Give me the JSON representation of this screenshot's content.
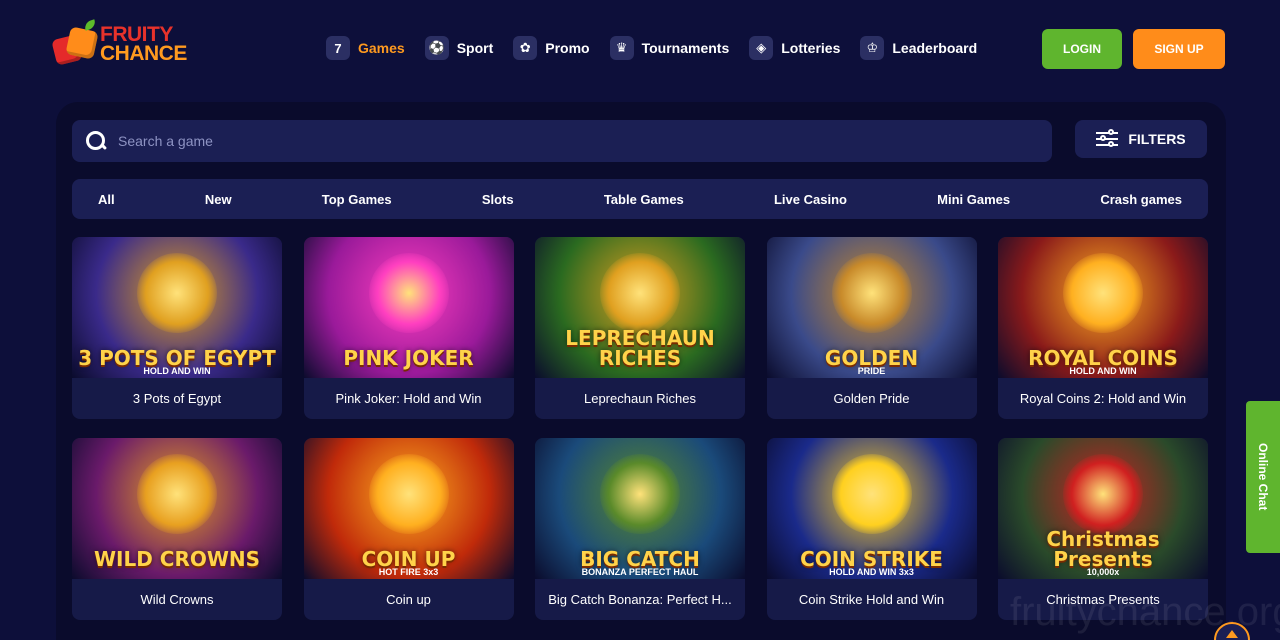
{
  "brand": {
    "line1": "FRUITY",
    "line2": "CHANCE"
  },
  "nav": {
    "items": [
      {
        "label": "Games",
        "icon": "seven-icon",
        "glyph": "7",
        "active": true
      },
      {
        "label": "Sport",
        "icon": "ball-icon",
        "glyph": "⚽",
        "active": false
      },
      {
        "label": "Promo",
        "icon": "clover-icon",
        "glyph": "✿",
        "active": false
      },
      {
        "label": "Tournaments",
        "icon": "trophy-icon",
        "glyph": "♛",
        "active": false
      },
      {
        "label": "Lotteries",
        "icon": "dice-icon",
        "glyph": "◈",
        "active": false
      },
      {
        "label": "Leaderboard",
        "icon": "crown-icon",
        "glyph": "♔",
        "active": false
      }
    ],
    "login": "LOGIN",
    "signup": "SIGN UP"
  },
  "search": {
    "placeholder": "Search a game",
    "filters_label": "FILTERS"
  },
  "categories": [
    "All",
    "New",
    "Top Games",
    "Slots",
    "Table Games",
    "Live Casino",
    "Mini Games",
    "Crash games"
  ],
  "games": [
    {
      "name": "3 Pots of Egypt",
      "art_title": "3 POTS OF EGYPT",
      "art_sub": "HOLD AND WIN",
      "bg": "#3a2a8a",
      "accent": "#e0a020"
    },
    {
      "name": "Pink Joker: Hold and Win",
      "art_title": "PINK JOKER",
      "art_sub": "",
      "bg": "#9a1a9a",
      "accent": "#ff3fc0"
    },
    {
      "name": "Leprechaun Riches",
      "art_title": "LEPRECHAUN RICHES",
      "art_sub": "",
      "bg": "#2a6a20",
      "accent": "#e0a020"
    },
    {
      "name": "Golden Pride",
      "art_title": "GOLDEN",
      "art_sub": "PRIDE",
      "bg": "#3a4a8a",
      "accent": "#c88a2a"
    },
    {
      "name": "Royal Coins 2: Hold and Win",
      "art_title": "ROYAL COINS",
      "art_sub": "HOLD AND WIN",
      "bg": "#8a1a1a",
      "accent": "#ffb020"
    },
    {
      "name": "Wild Crowns",
      "art_title": "WILD CROWNS",
      "art_sub": "",
      "bg": "#6a1a6a",
      "accent": "#e8a020"
    },
    {
      "name": "Coin up",
      "art_title": "COIN UP",
      "art_sub": "HOT FIRE 3x3",
      "bg": "#c02a0a",
      "accent": "#ffb020"
    },
    {
      "name": "Big Catch Bonanza: Perfect H...",
      "art_title": "BIG CATCH",
      "art_sub": "BONANZA PERFECT HAUL",
      "bg": "#1a4a7a",
      "accent": "#5a8a2a"
    },
    {
      "name": "Coin Strike Hold and Win",
      "art_title": "COIN STRIKE",
      "art_sub": "HOLD AND WIN 3x3",
      "bg": "#1a2a8a",
      "accent": "#ffd020"
    },
    {
      "name": "Christmas Presents",
      "art_title": "Christmas Presents",
      "art_sub": "10,000x",
      "bg": "#2a4a2a",
      "accent": "#d02020"
    }
  ],
  "chat": {
    "label": "Online Chat"
  },
  "watermark": "fruitychance.org.uk"
}
